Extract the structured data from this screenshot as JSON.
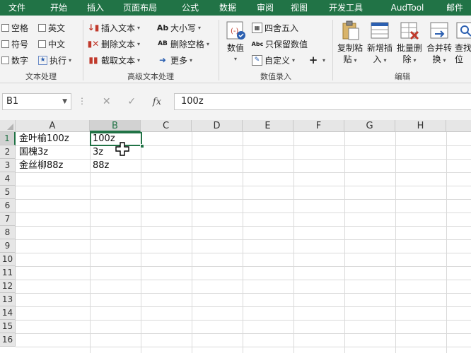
{
  "menu": [
    "文件",
    "开始",
    "插入",
    "页面布局",
    "公式",
    "数据",
    "审阅",
    "视图",
    "开发工具",
    "AudTool",
    "邮件"
  ],
  "ribbon": {
    "group_text": {
      "label": "文本处理",
      "items": [
        "空格",
        "英文",
        "符号",
        "中文",
        "数字",
        "执行"
      ]
    },
    "group_adv": {
      "label": "高级文本处理",
      "insert_text": "插入文本",
      "delete_text": "删除文本",
      "extract_text": "截取文本",
      "case": "大小写",
      "delete_space": "删除空格",
      "more": "更多",
      "case_icon": "Ab",
      "space_icon": "AB"
    },
    "group_num": {
      "label": "数值录入",
      "value": "数值",
      "round": "四舍五入",
      "keep_value": "只保留数值",
      "custom": "自定义",
      "abc_icon": "Abc"
    },
    "group_edit": {
      "label": "编辑",
      "copy_paste": [
        "复制粘",
        "贴"
      ],
      "insert_new": [
        "新增插",
        "入"
      ],
      "batch_delete": [
        "批量删",
        "除"
      ],
      "merge_convert": [
        "合并转",
        "换"
      ],
      "find_locate": [
        "查找",
        "位"
      ]
    }
  },
  "formula_bar": {
    "name_box": "B1",
    "fx": "fx",
    "cancel": "✕",
    "enter": "✓",
    "value": "100z"
  },
  "columns": [
    "A",
    "B",
    "C",
    "D",
    "E",
    "F",
    "G",
    "H"
  ],
  "rows": [
    "1",
    "2",
    "3",
    "4",
    "5",
    "6",
    "7",
    "8",
    "9",
    "10",
    "11",
    "12",
    "13",
    "14",
    "15",
    "16"
  ],
  "cells": {
    "A1": "金叶榆100z",
    "B1": "100z",
    "A2": "国槐3z",
    "B2": "3z",
    "A3": "金丝柳88z",
    "B3": "88z"
  },
  "selected_cell": "B1",
  "colors": {
    "accent": "#217346"
  }
}
